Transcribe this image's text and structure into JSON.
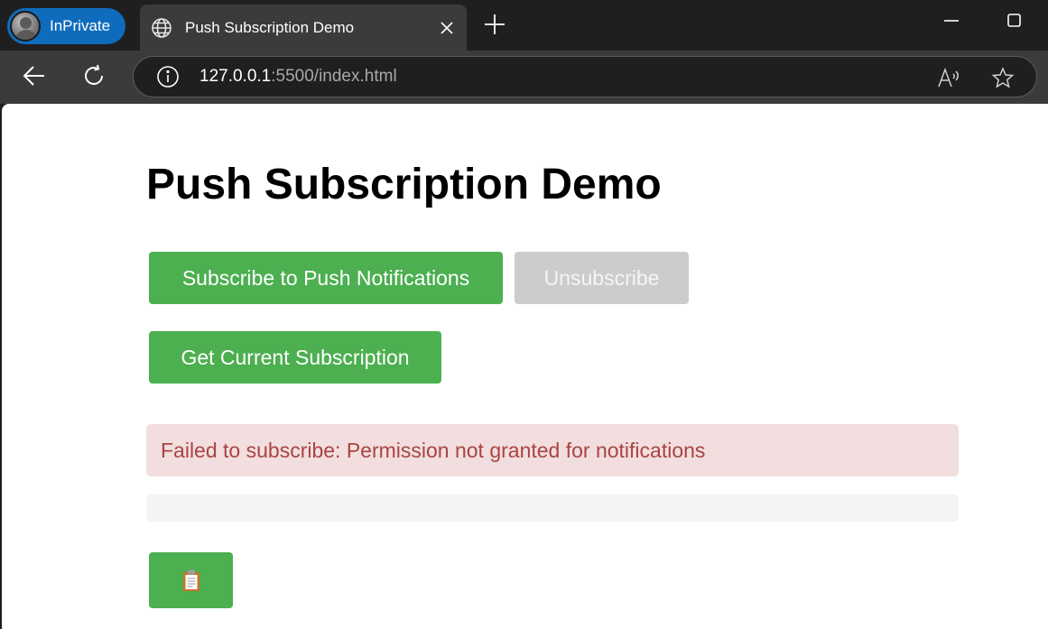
{
  "browser": {
    "inprivate_label": "InPrivate",
    "tab_title": "Push Subscription Demo",
    "url_host": "127.0.0.1",
    "url_rest": ":5500/index.html"
  },
  "page": {
    "heading": "Push Subscription Demo",
    "subscribe_label": "Subscribe to Push Notifications",
    "unsubscribe_label": "Unsubscribe",
    "get_subscription_label": "Get Current Subscription",
    "status_message": "Failed to subscribe: Permission not granted for notifications",
    "output_text": "",
    "copy_icon": "clipboard-icon"
  },
  "colors": {
    "button_green": "#4caf50",
    "button_disabled": "#cccccc",
    "error_bg": "#f2dede",
    "error_text": "#a94442",
    "inprivate_blue": "#0f6cbd"
  }
}
